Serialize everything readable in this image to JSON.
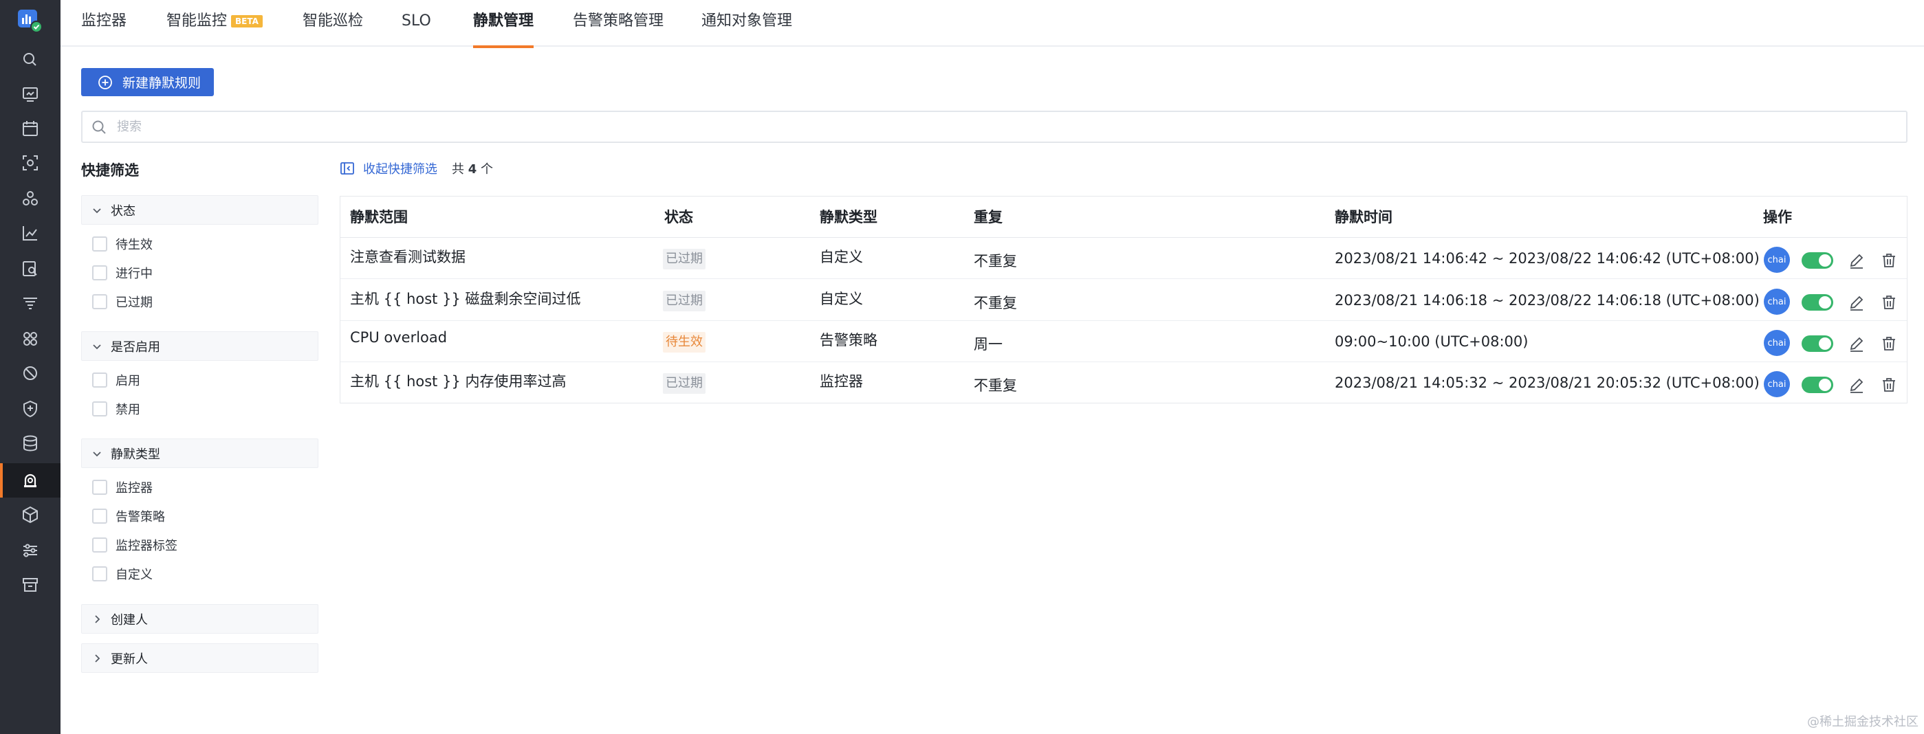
{
  "nav_tabs": [
    {
      "label": "监控器"
    },
    {
      "label": "智能监控",
      "badge": "BETA"
    },
    {
      "label": "智能巡检"
    },
    {
      "label": "SLO"
    },
    {
      "label": "静默管理",
      "active": true
    },
    {
      "label": "告警策略管理"
    },
    {
      "label": "通知对象管理"
    }
  ],
  "sidebar_icons": [
    "search-icon",
    "dashboard-icon",
    "calendar-icon",
    "scan-icon",
    "cluster-icon",
    "chart-icon",
    "log-search-icon",
    "filter-list-icon",
    "apps-icon",
    "ban-icon",
    "shield-icon",
    "database-icon",
    "alarm-icon",
    "cube-icon",
    "sliders-icon",
    "box-icon"
  ],
  "toolbar": {
    "new_rule_label": "新建静默规则"
  },
  "search": {
    "placeholder": "搜索",
    "value": ""
  },
  "quick_filter": {
    "title": "快捷筛选",
    "groups": [
      {
        "title": "状态",
        "expanded": true,
        "options": [
          "待生效",
          "进行中",
          "已过期"
        ]
      },
      {
        "title": "是否启用",
        "expanded": true,
        "options": [
          "启用",
          "禁用"
        ]
      },
      {
        "title": "静默类型",
        "expanded": true,
        "options": [
          "监控器",
          "告警策略",
          "监控器标签",
          "自定义"
        ]
      },
      {
        "title": "创建人",
        "expanded": false,
        "options": []
      },
      {
        "title": "更新人",
        "expanded": false,
        "options": []
      }
    ]
  },
  "list": {
    "collapse_label": "收起快捷筛选",
    "total_prefix": "共",
    "total_count": "4",
    "total_suffix": "个"
  },
  "table": {
    "columns": [
      "静默范围",
      "状态",
      "静默类型",
      "重复",
      "静默时间",
      "操作"
    ],
    "rows": [
      {
        "scope": "注意查看测试数据",
        "status": "已过期",
        "status_kind": "expired",
        "type": "自定义",
        "repeat": "不重复",
        "time": "2023/08/21 14:06:42 ~ 2023/08/22 14:06:42 (UTC+08:00)",
        "owner": "chai",
        "enabled": true
      },
      {
        "scope": "主机 {{ host }} 磁盘剩余空间过低",
        "status": "已过期",
        "status_kind": "expired",
        "type": "自定义",
        "repeat": "不重复",
        "time": "2023/08/21 14:06:18 ~ 2023/08/22 14:06:18 (UTC+08:00)",
        "owner": "chai",
        "enabled": true
      },
      {
        "scope": "CPU overload",
        "status": "待生效",
        "status_kind": "pending",
        "type": "告警策略",
        "repeat": "周一",
        "time": "09:00~10:00 (UTC+08:00)",
        "owner": "chai",
        "enabled": true
      },
      {
        "scope": "主机 {{ host }} 内存使用率过高",
        "status": "已过期",
        "status_kind": "expired",
        "type": "监控器",
        "repeat": "不重复",
        "time": "2023/08/21 14:05:32 ~ 2023/08/21 20:05:32 (UTC+08:00)",
        "owner": "chai",
        "enabled": true
      }
    ]
  },
  "watermark": "@稀土掘金技术社区",
  "colors": {
    "brand": "#3568d4",
    "accent": "#f27a2a",
    "toggle_on": "#36b56a",
    "avatar": "#3d7be6",
    "rail_bg": "#2b2e36"
  }
}
